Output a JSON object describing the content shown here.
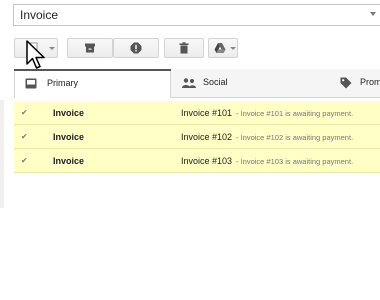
{
  "search": {
    "value": "Invoice"
  },
  "tabs": [
    {
      "label": "Primary",
      "icon": "inbox-icon"
    },
    {
      "label": "Social",
      "icon": "people-icon"
    },
    {
      "label": "Prome",
      "icon": "tag-icon"
    }
  ],
  "toolbar": {
    "select_icon": "checkbox-icon",
    "archive_icon": "archive-icon",
    "spam_icon": "report-spam-icon",
    "delete_icon": "trash-icon",
    "move_icon": "drive-icon"
  },
  "emails": [
    {
      "sender": "Invoice",
      "subject": "Invoice #101",
      "snippet": " - Invoice #101 is awaiting payment."
    },
    {
      "sender": "Invoice",
      "subject": "Invoice #102",
      "snippet": " - Invoice #102 is awaiting payment."
    },
    {
      "sender": "Invoice",
      "subject": "Invoice #103",
      "snippet": " - Invoice #103 is awaiting payment."
    }
  ],
  "colors": {
    "highlight_row": "#ffffc6",
    "tab_active_border": "#555555"
  }
}
